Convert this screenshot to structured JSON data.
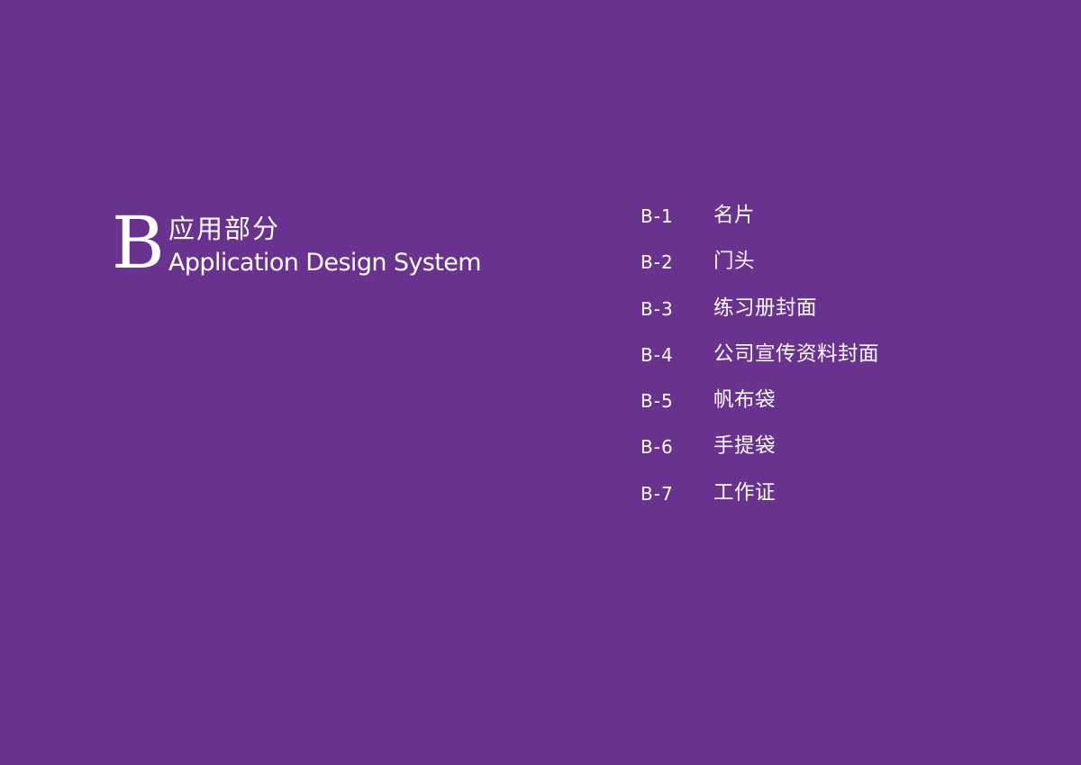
{
  "section": {
    "letter": "B",
    "title_cn": "应用部分",
    "title_en": "Application Design System"
  },
  "toc": {
    "items": [
      {
        "code": "B-1",
        "label": "名片"
      },
      {
        "code": "B-2",
        "label": "门头"
      },
      {
        "code": "B-3",
        "label": "练习册封面"
      },
      {
        "code": "B-4",
        "label": "公司宣传资料封面"
      },
      {
        "code": "B-5",
        "label": "帆布袋"
      },
      {
        "code": "B-6",
        "label": "手提袋"
      },
      {
        "code": "B-7",
        "label": "工作证"
      }
    ]
  },
  "colors": {
    "background": "#68328e",
    "text": "#ffffff"
  }
}
